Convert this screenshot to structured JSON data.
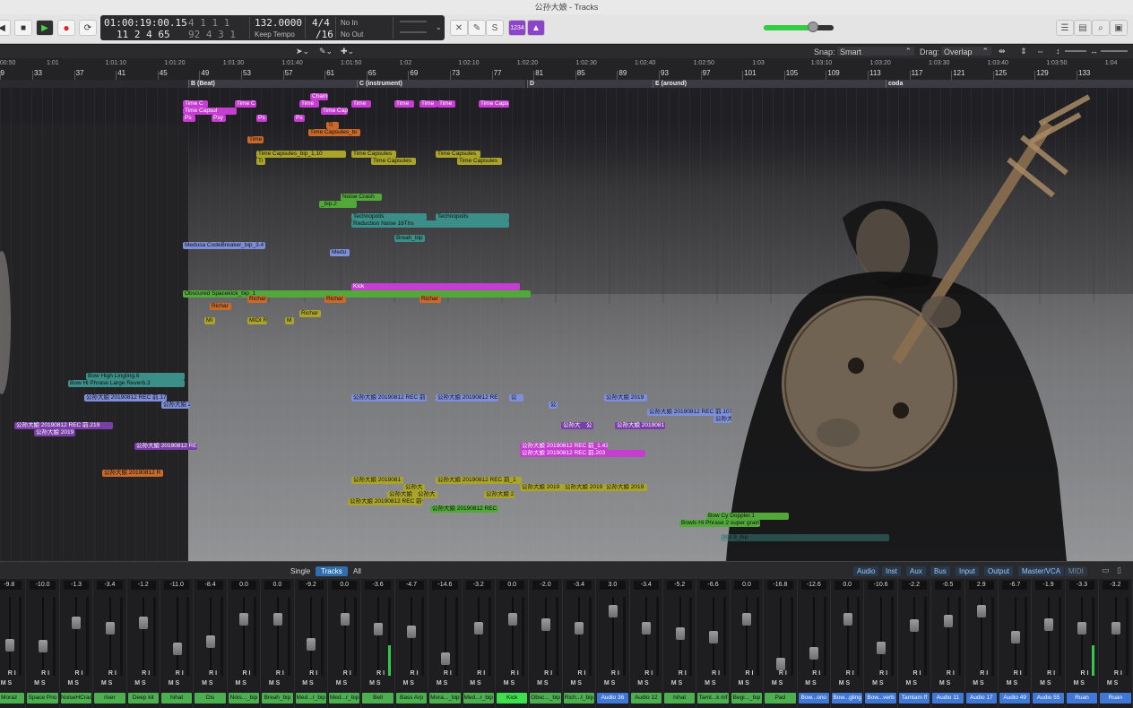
{
  "window": {
    "title": "公孙大娘 - Tracks"
  },
  "transport": {
    "play": "▶",
    "stop": "■",
    "record": "●",
    "cycle": "⟳"
  },
  "lcd": {
    "timecode": "01:00:19:00.15",
    "position": "11  2  4    65",
    "small_top": "4  1  1    1",
    "small_bottom": "92  4  3    1",
    "tempo": "132.0000",
    "tempo_mode": "Keep Tempo",
    "sig_num": "4/4",
    "sig_den": "/16",
    "midi_in": "No In",
    "midi_out": "No Out"
  },
  "control": {
    "count_in": "1234",
    "master_level": 0.7
  },
  "toolbar": {
    "snap_label": "Snap:",
    "snap_value": "Smart",
    "drag_label": "Drag:",
    "drag_value": "Overlap"
  },
  "ruler": {
    "times": [
      "1:00:50",
      "1:01",
      "1:01:10",
      "1:01:20",
      "1:01:30",
      "1:01:40",
      "1:01:50",
      "1:02",
      "1:02:10",
      "1:02:20",
      "1:02:30",
      "1:02:40",
      "1:02:50",
      "1:03",
      "1:03:10",
      "1:03:20",
      "1:03:30",
      "1:03:40",
      "1:03:50",
      "1:04"
    ],
    "bars": [
      "29",
      "33",
      "37",
      "41",
      "45",
      "49",
      "53",
      "57",
      "61",
      "65",
      "69",
      "73",
      "77",
      "81",
      "85",
      "89",
      "93",
      "97",
      "101",
      "105",
      "109",
      "113",
      "117",
      "121",
      "125",
      "129",
      "133"
    ]
  },
  "markers": [
    "B (Beat)",
    "C (instrument)",
    "D",
    "E (around)",
    "coda"
  ],
  "regions": [
    [
      "Time C",
      "mag"
    ],
    [
      "Time Capsul",
      "mag"
    ],
    [
      "Ps",
      "mag"
    ],
    [
      "Psy",
      "mag"
    ],
    [
      "Time C",
      "mag"
    ],
    [
      "Ps",
      "mag"
    ],
    [
      "Ps",
      "mag"
    ],
    [
      "Cham",
      "mag"
    ],
    [
      "Time",
      "mag"
    ],
    [
      "Time Cap",
      "mag"
    ],
    [
      "Time",
      "mag"
    ],
    [
      "Time",
      "mag"
    ],
    [
      "Time",
      "mag"
    ],
    [
      "Time",
      "mag"
    ],
    [
      "Time Caps",
      "mag"
    ],
    [
      "Ti",
      "ora"
    ],
    [
      "Time Capsules_bi",
      "ora"
    ],
    [
      "Time",
      "ora"
    ],
    [
      "Time Capsules_bip_1.10",
      "yel"
    ],
    [
      "Ti",
      "yel"
    ],
    [
      "Time Capsules",
      "yel"
    ],
    [
      "Time Capsules",
      "yel"
    ],
    [
      "Time Capsules",
      "yel"
    ],
    [
      "Time Capsules",
      "yel"
    ],
    [
      "Noise Crash",
      "grn"
    ],
    [
      "_bip.2",
      "grn"
    ],
    [
      "Technopolis",
      "tea"
    ],
    [
      "Technopolis",
      "tea"
    ],
    [
      "Reduction Noise 16Ths",
      "tea"
    ],
    [
      "Breah_bip",
      "tea"
    ],
    [
      "Medusa CodeBreaker_bip_3.4",
      "blu"
    ],
    [
      "Medu",
      "blu"
    ],
    [
      "Kick",
      "mag"
    ],
    [
      "Obscured Spacekick_bip_1",
      "grn"
    ],
    [
      "Richar",
      "ora"
    ],
    [
      "Richar",
      "ora"
    ],
    [
      "Richar",
      "ora"
    ],
    [
      "Richar",
      "ora"
    ],
    [
      "Richar",
      "yel"
    ],
    [
      "MI",
      "yel"
    ],
    [
      "MIDI R",
      "yel"
    ],
    [
      "M",
      "yel"
    ],
    [
      "Bow High Lingling.6",
      "tea"
    ],
    [
      "Bow Hi Phrase Large Reverb.3",
      "tea"
    ],
    [
      "公孙大娘 20190812 REC 前.17",
      "blu"
    ],
    [
      "公孙大娘 2",
      "blu"
    ],
    [
      "公孙大娘 20190812 REC 前",
      "blu"
    ],
    [
      "公孙大娘 20190812 RE",
      "blu"
    ],
    [
      "公",
      "blu"
    ],
    [
      "公",
      "blu"
    ],
    [
      "公孙大娘 2019",
      "blu"
    ],
    [
      "公孙大娘 20190812 REC 前.107",
      "blu"
    ],
    [
      "公孙大",
      "blu"
    ],
    [
      "公孙大",
      "pur"
    ],
    [
      "公",
      "pur"
    ],
    [
      "公孙大娘 20190812 REC 前.219",
      "pur"
    ],
    [
      "公孙大娘 2019",
      "pur"
    ],
    [
      "公孙大娘 2019081",
      "pur"
    ],
    [
      "公孙大娘 20190812 RE",
      "pur"
    ],
    [
      "公孙大娘 20190812 REC 前_1.43",
      "mag"
    ],
    [
      "公孙大娘 20190812 REC 前.203",
      "mag"
    ],
    [
      "公孙大娘 20190812 R",
      "ora"
    ],
    [
      "公孙大娘 2019081",
      "yel"
    ],
    [
      "公孙大",
      "yel"
    ],
    [
      "公孙大娘 20190812 REC 前_1",
      "yel"
    ],
    [
      "公孙大娘 2019",
      "yel"
    ],
    [
      "公孙大娘 2019",
      "yel"
    ],
    [
      "公孙大娘 2019",
      "yel"
    ],
    [
      "公孙大娘",
      "yel"
    ],
    [
      "公孙大",
      "yel"
    ],
    [
      "公孙大娘 2",
      "yel"
    ],
    [
      "公孙大娘 20190812 REC 前子",
      "yel"
    ],
    [
      "公孙大娘 20190812 REC",
      "grn"
    ],
    [
      "Bow Cy Doppler.1",
      "grn"
    ],
    [
      "Bowls Hi Phrase 2 super grain",
      "grn"
    ],
    [
      "Inst 9_bip",
      "tea"
    ]
  ],
  "mixer": {
    "tabs": [
      "Single",
      "Tracks",
      "All"
    ],
    "filters": [
      "Audio",
      "Inst",
      "Aux",
      "Bus",
      "Input",
      "Output",
      "Master/VCA",
      "MIDI"
    ],
    "strips": [
      [
        "Moraz",
        "-9.8",
        "#4caf50"
      ],
      [
        "Space Pno",
        "-10.0",
        "#4caf50"
      ],
      [
        "NoiseHCras",
        "-1.3",
        "#4caf50"
      ],
      [
        "riser",
        "-3.4",
        "#4caf50"
      ],
      [
        "Deep kit",
        "-1.2",
        "#4caf50"
      ],
      [
        "hihat",
        "-11.0",
        "#4caf50"
      ],
      [
        "Dis",
        "-8.4",
        "#4caf50"
      ],
      [
        "Nois..._bip",
        "0.0",
        "#4caf50"
      ],
      [
        "Breah_bip",
        "0.0",
        "#4caf50"
      ],
      [
        "Med...r_bip",
        "-9.2",
        "#4caf50"
      ],
      [
        "Med...r_bip",
        "0.0",
        "#4caf50"
      ],
      [
        "Bell",
        "-3.6",
        "#4caf50"
      ],
      [
        "Bass Arp",
        "-4.7",
        "#4caf50"
      ],
      [
        "Mora..._bip",
        "-14.6",
        "#4caf50"
      ],
      [
        "Med...r_bip",
        "-3.2",
        "#4caf50"
      ],
      [
        "Kick",
        "0.0",
        "#3fe04d"
      ],
      [
        "Obsc..._bip",
        "-2.0",
        "#4caf50"
      ],
      [
        "Rich...t_bip",
        "-3.4",
        "#4caf50"
      ],
      [
        "Audio 36",
        "3.0",
        "#3f78d6"
      ],
      [
        "Audio 12",
        "-3.4",
        "#4caf50"
      ],
      [
        "hihat",
        "-5.2",
        "#4caf50"
      ],
      [
        "Tamt...k mf",
        "-6.6",
        "#4caf50"
      ],
      [
        "Begi..._bip",
        "0.0",
        "#4caf50"
      ],
      [
        "Pad",
        "-16.8",
        "#4caf50"
      ],
      [
        "Bow...ono",
        "-12.6",
        "#3f78d6"
      ],
      [
        "Bow...gling",
        "0.0",
        "#3f78d6"
      ],
      [
        "Bow...verb",
        "-10.6",
        "#3f78d6"
      ],
      [
        "Tamtam ff",
        "-2.2",
        "#3f78d6"
      ],
      [
        "Audio 11",
        "-0.5",
        "#3f78d6"
      ],
      [
        "Audio 17",
        "2.9",
        "#3f78d6"
      ],
      [
        "Audio 49",
        "-6.7",
        "#3f78d6"
      ],
      [
        "Audio 55",
        "-1.9",
        "#3f78d6"
      ],
      [
        "Ruan",
        "-3.3",
        "#3f78d6"
      ],
      [
        "Ruan",
        "-3.2",
        "#3f78d6"
      ]
    ]
  }
}
